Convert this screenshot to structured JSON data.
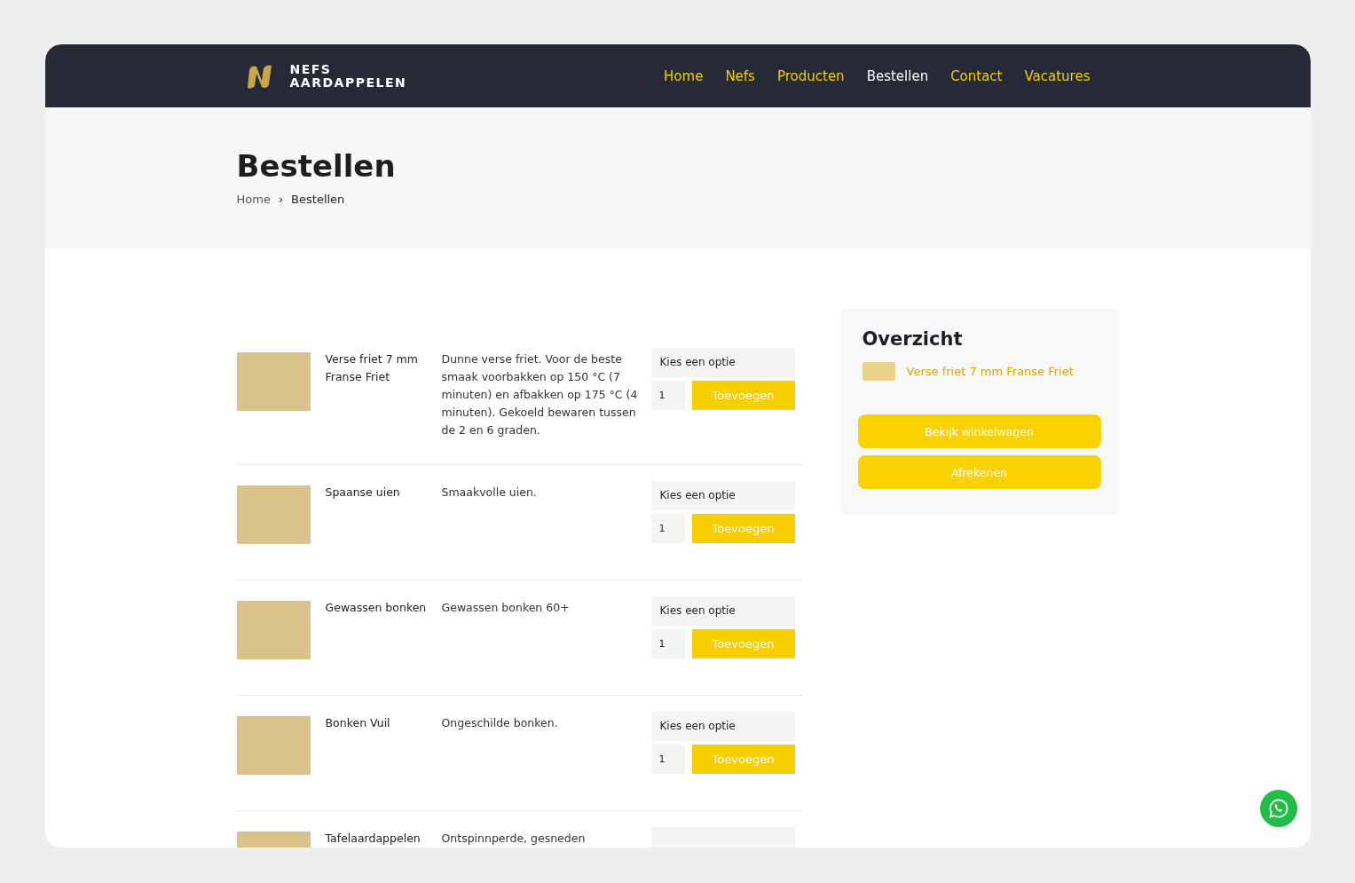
{
  "brand": {
    "line_1": "NEFS",
    "line_2": "AARDAPPELEN"
  },
  "nav": [
    {
      "label": "Home",
      "selected": false
    },
    {
      "label": "Nefs",
      "selected": false
    },
    {
      "label": "Producten",
      "selected": false
    },
    {
      "label": "Bestellen",
      "selected": true
    },
    {
      "label": "Contact",
      "selected": false
    },
    {
      "label": "Vacatures",
      "selected": false
    }
  ],
  "page_title": "Bestellen",
  "breadcrumb": {
    "items": [
      "Home",
      "Bestellen"
    ],
    "separator": "›"
  },
  "products": [
    {
      "name": "Verse friet 7 mm Franse Friet",
      "description": "Dunne verse friet. Voor de beste smaak voorbakken op 150 °C (7 minuten) en afbakken op 175 °C (4 minuten). Gekoeld bewaren tussen de 2 en 6 graden.",
      "option_placeholder": "Kies een optie",
      "quantity": "1",
      "button": "Toevoegen"
    },
    {
      "name": "Spaanse uien",
      "description": "Smaakvolle uien.",
      "option_placeholder": "Kies een optie",
      "quantity": "1",
      "button": "Toevoegen"
    },
    {
      "name": "Gewassen bonken",
      "description": "Gewassen bonken 60+",
      "option_placeholder": "Kies een optie",
      "quantity": "1",
      "button": "Toevoegen"
    },
    {
      "name": "Bonken Vuil",
      "description": "Ongeschilde bonken.",
      "option_placeholder": "Kies een optie",
      "quantity": "1",
      "button": "Toevoegen"
    },
    {
      "name": "Tafelaardappelen",
      "description": "Ontspinnperde, gesneden"
    }
  ],
  "overview": {
    "title": "Overzicht",
    "items": [
      {
        "name": "Verse friet 7 mm Franse Friet"
      }
    ],
    "buttons": [
      "Bekijk winkelwagen",
      "Afrekenen"
    ]
  }
}
